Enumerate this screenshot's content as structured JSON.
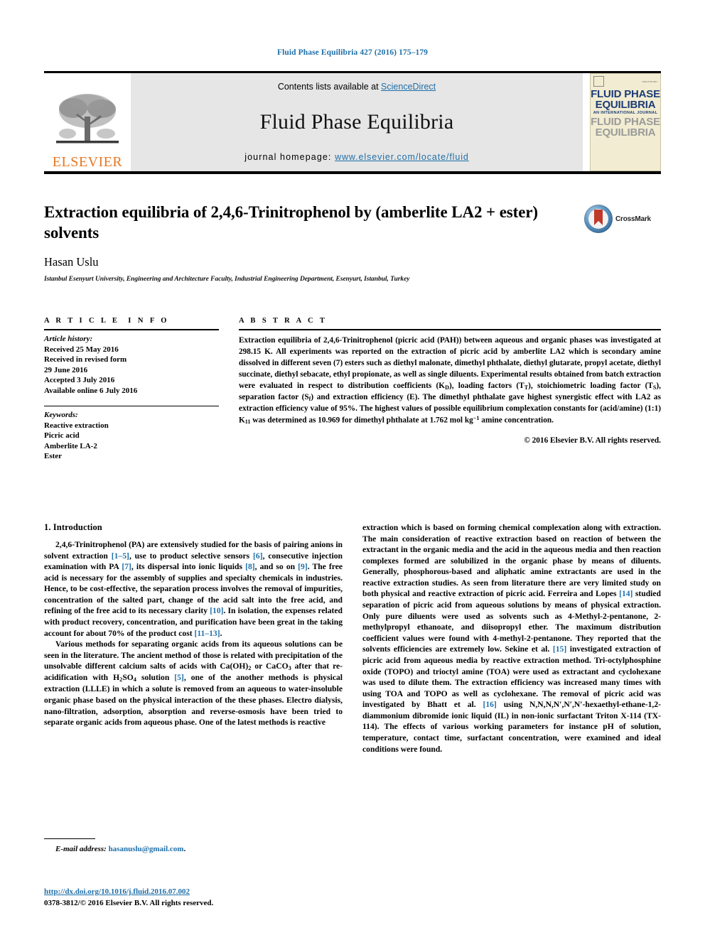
{
  "running_head": "Fluid Phase Equilibria 427 (2016) 175–179",
  "masthead": {
    "contents_prefix": "Contents lists available at ",
    "sciencedirect": "ScienceDirect",
    "journal_title": "Fluid Phase Equilibria",
    "homepage_prefix": "journal homepage: ",
    "homepage_url": "www.elsevier.com/locate/fluid",
    "publisher": "ELSEVIER",
    "cover": {
      "line1": "FLUID PHASE",
      "line2": "EQUILIBRIA",
      "subtitle": "AN INTERNATIONAL JOURNAL",
      "line3": "FLUID PHASE",
      "line4": "EQUILIBRIA"
    }
  },
  "article": {
    "title": "Extraction equilibria of 2,4,6-Trinitrophenol by (amberlite LA2 + ester) solvents",
    "author": "Hasan Uslu",
    "affiliation": "Istanbul Esenyurt University, Engineering and Architecture Faculty, Industrial Engineering Department, Esenyurt, Istanbul, Turkey",
    "crossmark_label": "CrossMark"
  },
  "article_info": {
    "heading": "ARTICLE INFO",
    "history_label": "Article history:",
    "history": [
      "Received 25 May 2016",
      "Received in revised form",
      "29 June 2016",
      "Accepted 3 July 2016",
      "Available online 6 July 2016"
    ],
    "keywords_label": "Keywords:",
    "keywords": [
      "Reactive extraction",
      "Picric acid",
      "Amberlite LA-2",
      "Ester"
    ]
  },
  "abstract": {
    "heading": "ABSTRACT",
    "text": "Extraction equilibria of 2,4,6-Trinitrophenol (picric acid (PAH)) between aqueous and organic phases was investigated at 298.15 K. All experiments was reported on the extraction of picric acid by amberlite LA2 which is secondary amine dissolved in different seven (7) esters such as diethyl malonate, dimethyl phthalate, diethyl glutarate, propyl acetate, diethyl succinate, diethyl sebacate, ethyl propionate, as well as single diluents. Experimental results obtained from batch extraction were evaluated in respect to distribution coefficients (KD), loading factors (TT), stoichiometric loading factor (TS), separation factor (Sf) and extraction efficiency (E). The dimethyl phthalate gave highest synergistic effect with LA2 as extraction efficiency value of 95%. The highest values of possible equilibrium complexation constants for (acid/amine) (1:1) K11 was determined as 10.969 for dimethyl phthalate at 1.762 mol kg−1 amine concentration.",
    "copyright": "© 2016 Elsevier B.V. All rights reserved."
  },
  "introduction": {
    "heading": "1. Introduction",
    "left_paragraphs": [
      "2,4,6-Trinitrophenol (PA) are extensively studied for the basis of pairing anions in solvent extraction [1–5], use to product selective sensors [6], consecutive injection examination with PA [7], its dispersal into ionic liquids [8], and so on [9]. The free acid is necessary for the assembly of supplies and specialty chemicals in industries. Hence, to be cost-effective, the separation process involves the removal of impurities, concentration of the salted part, change of the acid salt into the free acid, and refining of the free acid to its necessary clarity [10]. In isolation, the expenses related with product recovery, concentration, and purification have been great in the taking account for about 70% of the product cost [11–13].",
      "Various methods for separating organic acids from its aqueous solutions can be seen in the literature. The ancient method of those is related with precipitation of the unsolvable different calcium salts of acids with Ca(OH)2 or CaCO3 after that re-acidification with H2SO4 solution [5], one of the another methods is physical extraction (LLLE) in which a solute is removed from an aqueous to water-insoluble organic phase based on the physical interaction of the these phases. Electro dialysis, nano-filtration, adsorption, absorption and reverse-osmosis have been tried to separate organic acids from aqueous phase. One of the latest methods is reactive"
    ],
    "right_paragraphs": [
      "extraction which is based on forming chemical complexation along with extraction. The main consideration of reactive extraction based on reaction of between the extractant in the organic media and the acid in the aqueous media and then reaction complexes formed are solubilized in the organic phase by means of diluents. Generally, phosphorous-based and aliphatic amine extractants are used in the reactive extraction studies. As seen from literature there are very limited study on both physical and reactive extraction of picric acid. Ferreira and Lopes [14] studied separation of picric acid from aqueous solutions by means of physical extraction. Only pure diluents were used as solvents such as 4-Methyl-2-pentanone, 2-methylpropyl ethanoate, and diisopropyl ether. The maximum distribution coefficient values were found with 4-methyl-2-pentanone. They reported that the solvents efficiencies are extremely low. Sekine et al. [15] investigated extraction of picric acid from aqueous media by reactive extraction method. Tri-octylphosphine oxide (TOPO) and trioctyl amine (TOA) were used as extractant and cyclohexane was used to dilute them. The extraction efficiency was increased many times with using TOA and TOPO as well as cyclohexane. The removal of picric acid was investigated by Bhatt et al. [16] using N,N,N,N′,N′,N′-hexaethyl-ethane-1,2-diammonium dibromide ionic liquid (IL) in non-ionic surfactant Triton X-114 (TX-114). The effects of various working parameters for instance pH of solution, temperature, contact time, surfactant concentration, were examined and ideal conditions were found."
    ]
  },
  "footer": {
    "email_label": "E-mail address:",
    "email": "hasanuslu@gmail.com",
    "doi": "http://dx.doi.org/10.1016/j.fluid.2016.07.002",
    "issn_line": "0378-3812/© 2016 Elsevier B.V. All rights reserved."
  },
  "colors": {
    "link": "#1f6fa8",
    "elsevier_orange": "#E87722",
    "masthead_gray": "#e6e6e6",
    "cover_cream": "#f2edd2",
    "cover_blue": "#1d3c78"
  }
}
